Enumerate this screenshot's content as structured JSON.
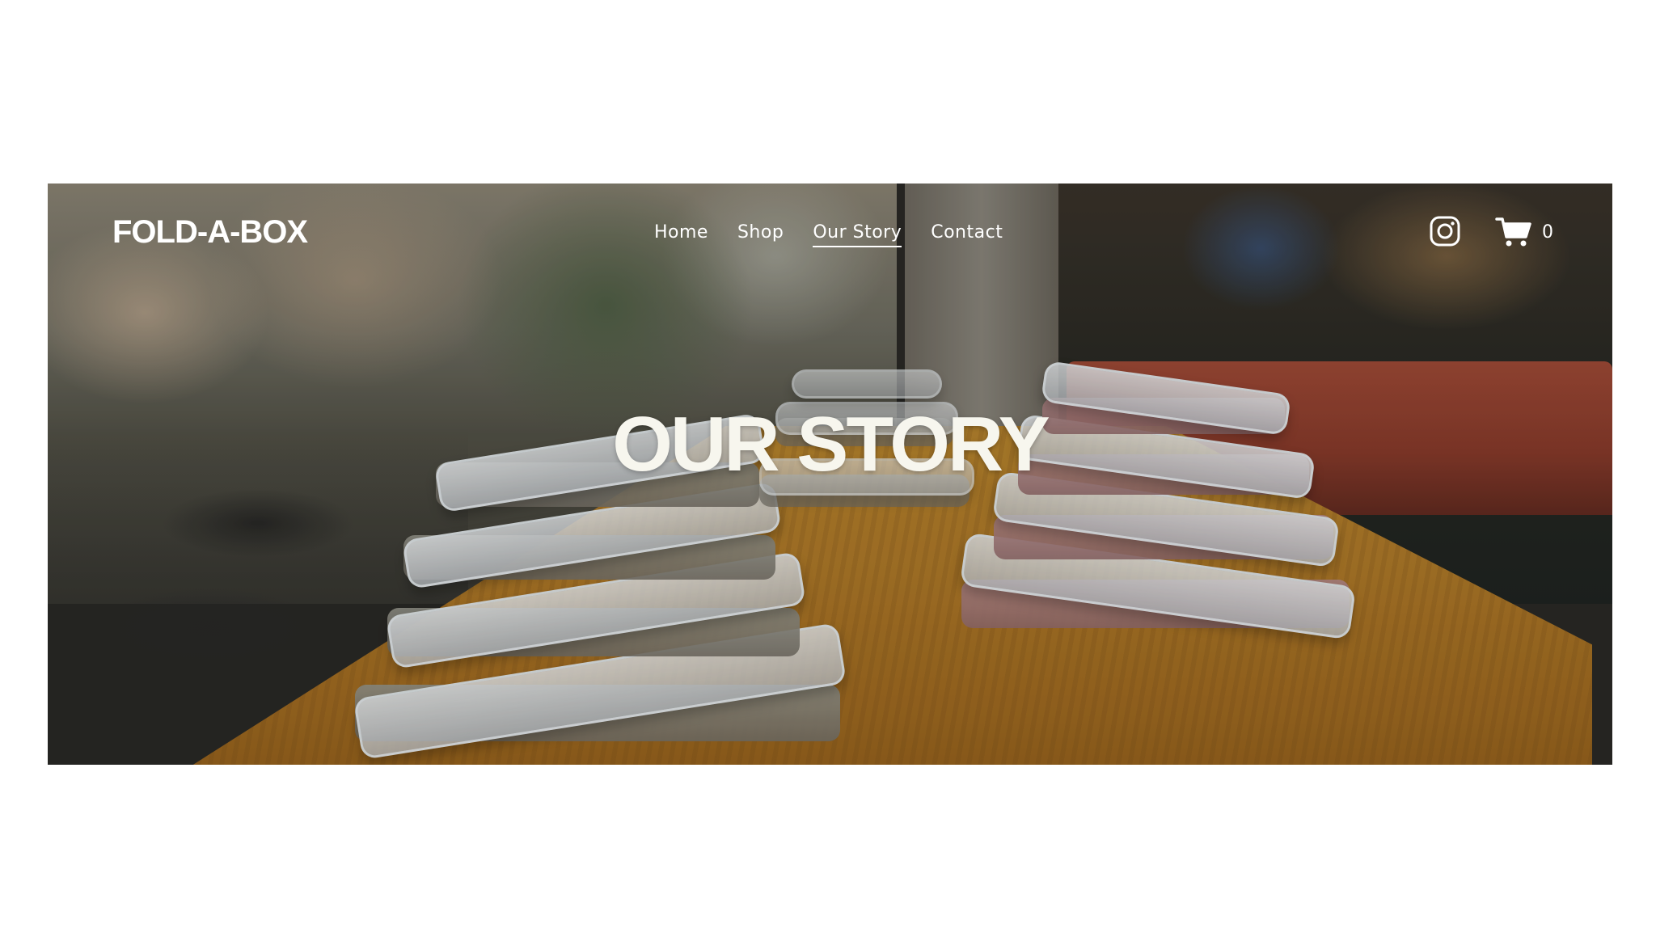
{
  "header": {
    "logo": "FOLD-A-BOX",
    "nav": [
      {
        "label": "Home",
        "active": false
      },
      {
        "label": "Shop",
        "active": false
      },
      {
        "label": "Our Story",
        "active": true
      },
      {
        "label": "Contact",
        "active": false
      }
    ],
    "social_icon": "instagram-icon",
    "cart": {
      "icon": "shopping-cart-icon",
      "count": "0"
    }
  },
  "hero": {
    "title": "OUR STORY",
    "background_description": "blurred cafe interior with stacked collapsible food containers on a wooden table"
  },
  "colors": {
    "text": "#ffffff",
    "headline": "#f7f6ee",
    "page_background": "#ffffff"
  }
}
